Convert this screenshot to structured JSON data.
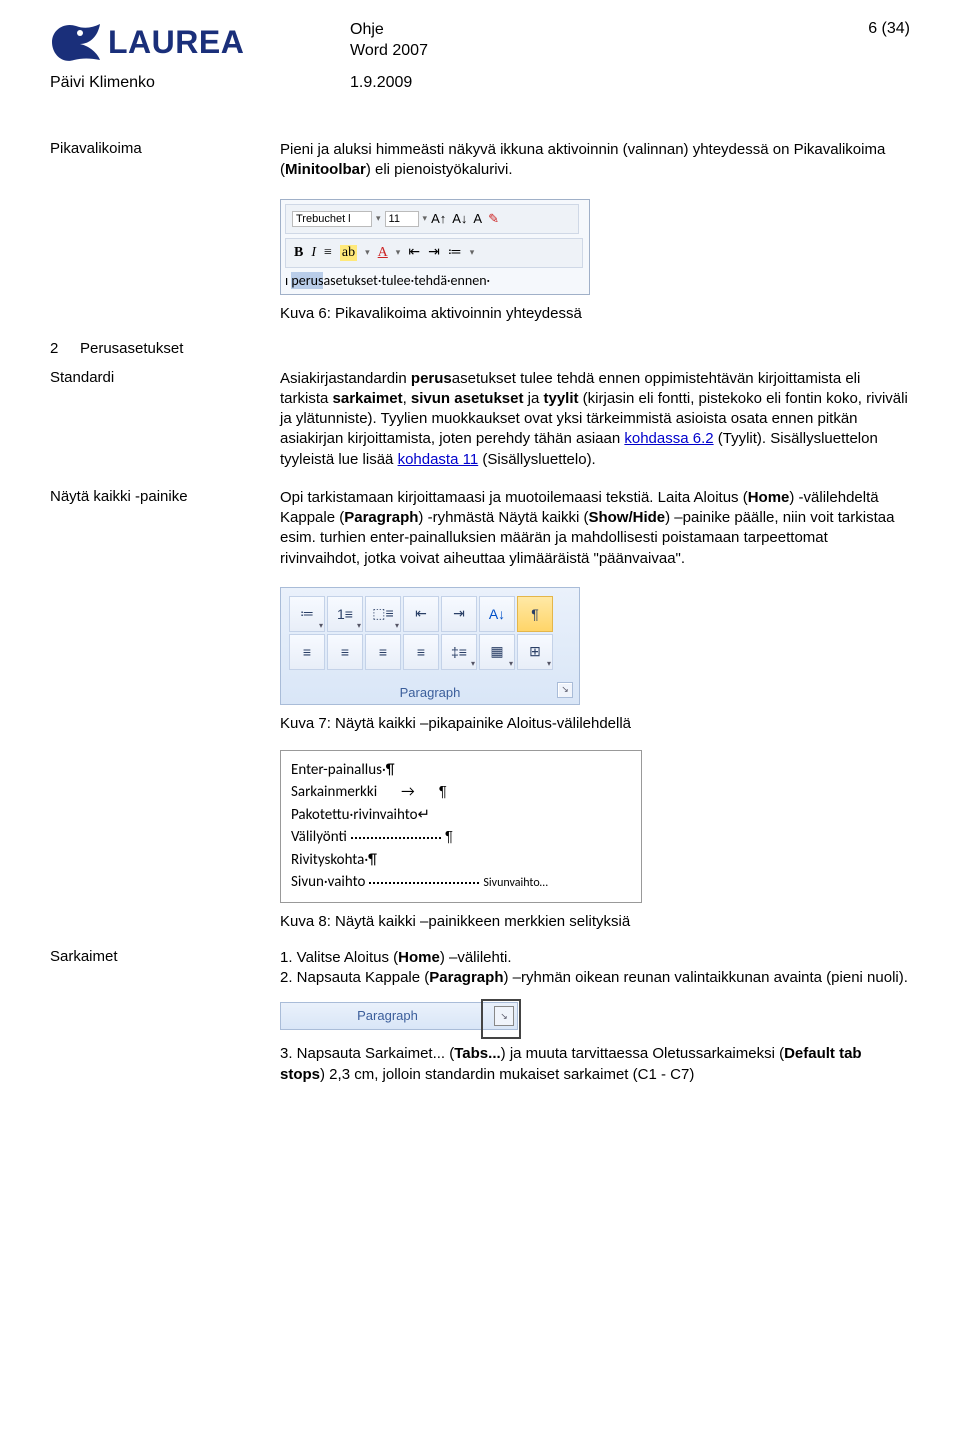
{
  "header": {
    "logo_text": "LAUREA",
    "doc_type": "Ohje",
    "doc_app": "Word 2007",
    "page_info": "6 (34)",
    "author": "Päivi Klimenko",
    "date": "1.9.2009"
  },
  "sections": {
    "pikavalikoima": {
      "label": "Pikavalikoima",
      "text_a": "Pieni ja aluksi himmeästi näkyvä ikkuna aktivoinnin (valinnan) yhteydessä on Pikavalikoima (",
      "bold_a": "Minitoolbar",
      "text_b": ") eli pienoistyökalurivi."
    },
    "fig6": {
      "font_name": "Trebuchet l",
      "font_size": "11",
      "sample_hl": "perus",
      "sample_rest": "asetukset·tulee·tehdä·ennen·",
      "caption": "Kuva 6: Pikavalikoima aktivoinnin yhteydessä"
    },
    "perusasetukset": {
      "num": "2",
      "title": "Perusasetukset"
    },
    "standardi": {
      "label": "Standardi",
      "t1": "Asiakirjastandardin ",
      "b1": "perus",
      "t2": "asetukset tulee tehdä ennen oppimistehtävän kirjoittamista eli tarkista ",
      "b2": "sarkaimet",
      "t3": ", ",
      "b3": "sivun asetukset",
      "t4": " ja ",
      "b4": "tyylit",
      "t5": " (kirjasin eli fontti, pistekoko eli fontin koko, riviväli ja ylätunniste). Tyylien muokkaukset ovat yksi tärkeimmistä asioista osata ennen pitkän asiakirjan kirjoittamista, joten perehdy tähän asiaan ",
      "link1": "kohdassa 6.2",
      "t6": " (Tyylit). Sisällysluettelon tyyleistä lue lisää ",
      "link2": "kohdasta 11",
      "t7": " (Sisällysluettelo)."
    },
    "nayta": {
      "label": "Näytä kaikki -painike",
      "t1": "Opi tarkistamaan kirjoittamaasi ja muotoilemaasi tekstiä. Laita Aloitus (",
      "b1": "Home",
      "t2": ") -välilehdeltä Kappale (",
      "b2": "Paragraph",
      "t3": ") -ryhmästä Näytä kaikki (",
      "b3": "Show/Hide",
      "t4": ") –painike päälle, niin voit tarkistaa esim. turhien enter-painalluksien määrän ja mahdollisesti poistamaan tarpeettomat rivinvaihdot, jotka voivat aiheuttaa ylimääräistä \"päänvaivaa\"."
    },
    "fig7": {
      "group_label": "Paragraph",
      "caption": "Kuva 7: Näytä kaikki –pikapainike Aloitus-välilehdellä"
    },
    "fig8": {
      "l1": "Enter-painallus·¶",
      "l2a": "Sarkainmerkki",
      "l2b": "→",
      "l2c": "¶",
      "l3": "Pakotettu·rivinvaihto↵",
      "l4a": "Välilyönti",
      "l4b": "¶",
      "l5": "Rivityskohta·¶",
      "l6a": "Sivun·vaihto",
      "l6b": "Sivunvaihto",
      "caption": "Kuva 8: Näytä kaikki –painikkeen merkkien selityksiä"
    },
    "sarkaimet": {
      "label": "Sarkaimet",
      "step1a": "1. Valitse Aloitus (",
      "step1b": "Home",
      "step1c": ") –välilehti.",
      "step2a": "2. Napsauta Kappale (",
      "step2b": "Paragraph",
      "step2c": ") –ryhmän oikean reunan valintaikkunan avainta (pieni nuoli).",
      "box_label": "Paragraph",
      "step3a": "3. Napsauta Sarkaimet... (",
      "step3b": "Tabs...",
      "step3c": ") ja muuta tarvittaessa Oletussarkaimeksi (",
      "step3d": "Default tab stops",
      "step3e": ") 2,3 cm, jolloin standardin mukaiset sarkaimet (C1 - C7)"
    }
  }
}
